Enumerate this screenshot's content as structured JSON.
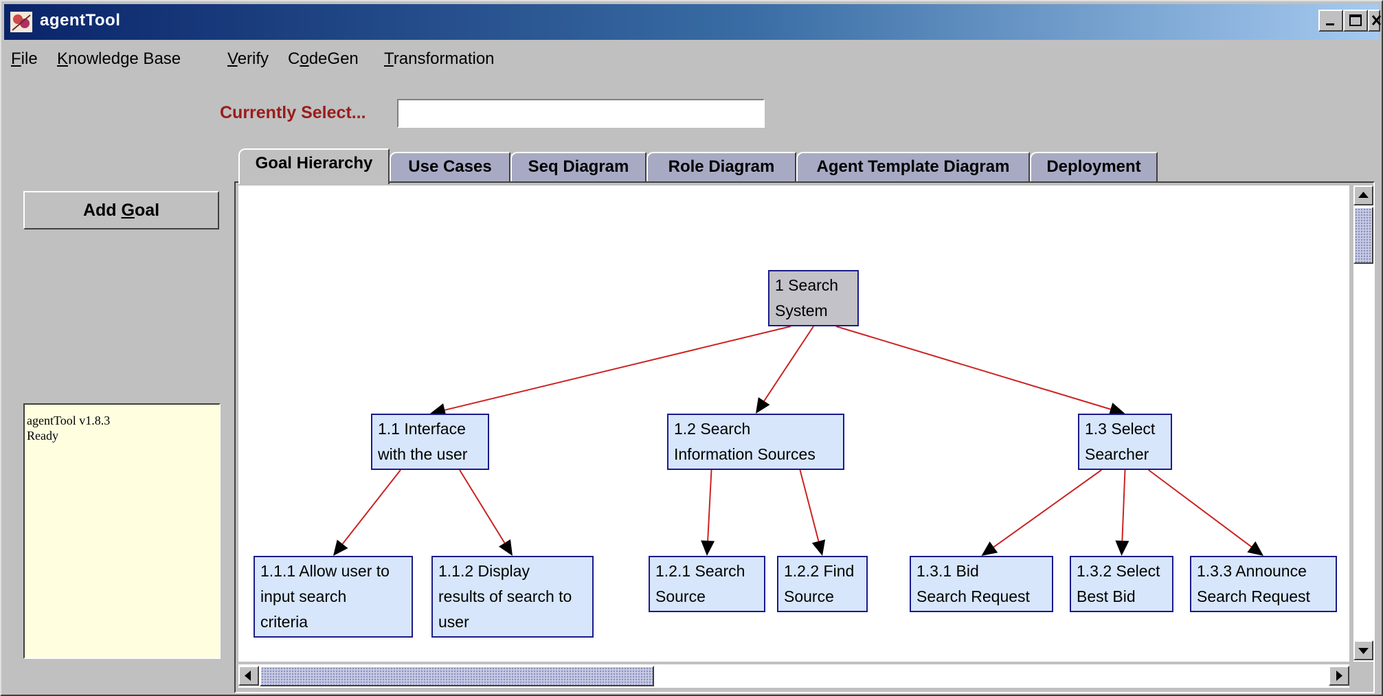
{
  "window": {
    "title": "agentTool",
    "controls": [
      "minimize-icon",
      "maximize-icon",
      "close-icon"
    ]
  },
  "menu": {
    "items": [
      {
        "mnemonic": "F",
        "rest": "ile"
      },
      {
        "mnemonic": "K",
        "rest": "nowledge Base"
      },
      {
        "mnemonic": "V",
        "rest": "erify"
      },
      {
        "pre": "C",
        "mnemonic": "o",
        "rest": "deGen"
      },
      {
        "mnemonic": "T",
        "rest": "ransformation"
      }
    ]
  },
  "selection": {
    "label": "Currently Select...",
    "value": ""
  },
  "tabs": [
    {
      "label": "Goal Hierarchy",
      "active": true
    },
    {
      "label": "Use Cases",
      "active": false
    },
    {
      "label": "Seq Diagram",
      "active": false
    },
    {
      "label": "Role Diagram",
      "active": false
    },
    {
      "label": "Agent Template Diagram",
      "active": false
    },
    {
      "label": "Deployment",
      "active": false
    }
  ],
  "add_goal": {
    "pre": "Add ",
    "mnemonic": "G",
    "rest": "oal"
  },
  "status": {
    "lines": [
      "agentTool v1.8.3",
      "Ready"
    ]
  },
  "goal_hierarchy": {
    "nodes": [
      {
        "id": "1",
        "lines": [
          "1 Search",
          "System"
        ],
        "root": true
      },
      {
        "id": "1.1",
        "lines": [
          "1.1 Interface",
          "with the user"
        ]
      },
      {
        "id": "1.2",
        "lines": [
          "1.2 Search",
          "Information Sources"
        ]
      },
      {
        "id": "1.3",
        "lines": [
          "1.3 Select",
          "Searcher"
        ]
      },
      {
        "id": "1.1.1",
        "lines": [
          "1.1.1 Allow user to",
          "input search",
          "criteria"
        ]
      },
      {
        "id": "1.1.2",
        "lines": [
          "1.1.2 Display",
          "results of search to",
          "user"
        ]
      },
      {
        "id": "1.2.1",
        "lines": [
          "1.2.1 Search",
          "Source"
        ]
      },
      {
        "id": "1.2.2",
        "lines": [
          "1.2.2 Find",
          "Source"
        ]
      },
      {
        "id": "1.3.1",
        "lines": [
          "1.3.1 Bid",
          "Search Request"
        ]
      },
      {
        "id": "1.3.2",
        "lines": [
          "1.3.2 Select",
          "Best Bid"
        ]
      },
      {
        "id": "1.3.3",
        "lines": [
          "1.3.3 Announce",
          "Search Request"
        ]
      }
    ],
    "edges": [
      [
        "1",
        "1.1"
      ],
      [
        "1",
        "1.2"
      ],
      [
        "1",
        "1.3"
      ],
      [
        "1.1",
        "1.1.1"
      ],
      [
        "1.1",
        "1.1.2"
      ],
      [
        "1.2",
        "1.2.1"
      ],
      [
        "1.2",
        "1.2.2"
      ],
      [
        "1.3",
        "1.3.1"
      ],
      [
        "1.3",
        "1.3.2"
      ],
      [
        "1.3",
        "1.3.3"
      ]
    ],
    "colors": {
      "edge": "#cc2222",
      "arrowhead": "#000000",
      "node_fill": "#d7e6fb",
      "root_fill": "#c2c2c8",
      "node_border": "#1a1a8a"
    }
  },
  "scroll": {
    "vertical_position": 0.0,
    "horizontal_position": 0.0
  }
}
